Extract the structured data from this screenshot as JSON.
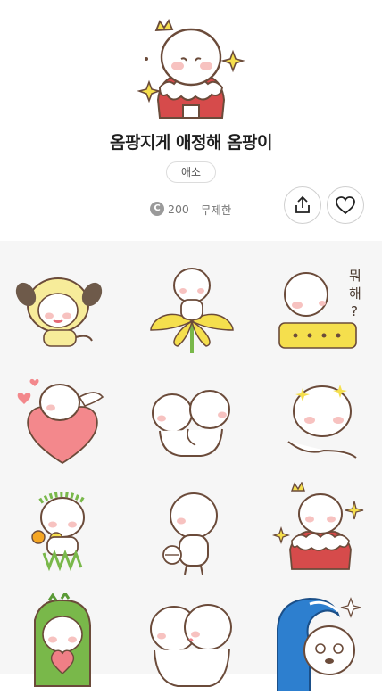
{
  "pack": {
    "title": "옴팡지게 애정해 옴팡이",
    "tag": "애소",
    "coin_symbol": "C",
    "price": "200",
    "duration": "무제한"
  },
  "icons": {
    "share": "share-icon",
    "like": "heart-icon"
  },
  "stickers": {
    "wae_line1": "뭐",
    "wae_line2": "해",
    "wae_line3": "?"
  },
  "colors": {
    "yellow": "#f5df4d",
    "pink": "#ef7f86",
    "green": "#79b84a",
    "blue": "#2d7fcf",
    "cheek": "#f7c2c0"
  }
}
